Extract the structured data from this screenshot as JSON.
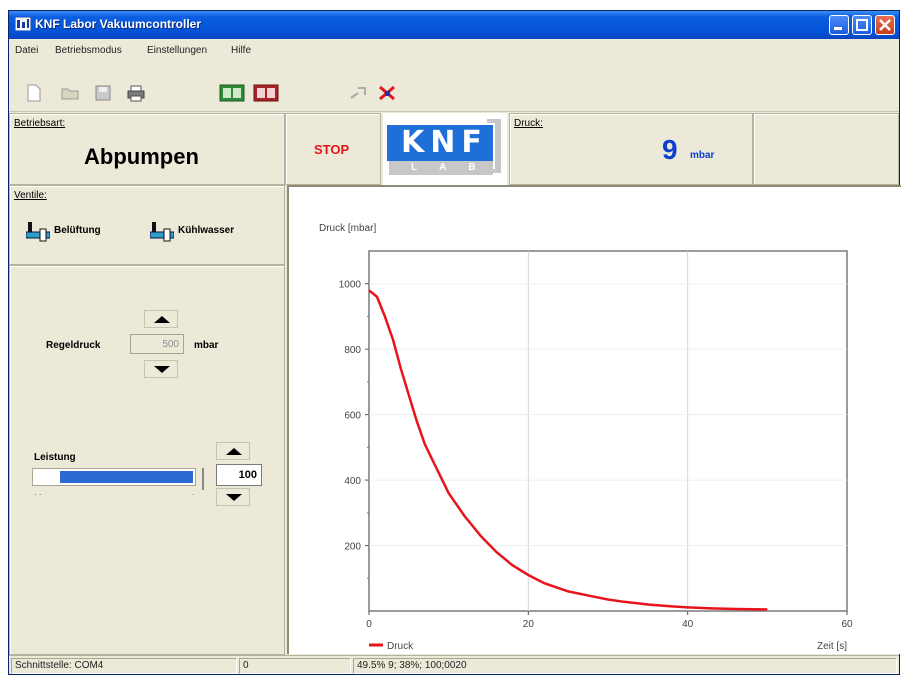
{
  "window": {
    "title": "KNF Labor Vakuumcontroller"
  },
  "menu": [
    "Datei",
    "Betriebsmodus",
    "Einstellungen",
    "Hilfe"
  ],
  "status_panel": {
    "label": "Betriebsart:",
    "value": "Abpumpen"
  },
  "stop_button": {
    "label": "STOP"
  },
  "logo": {
    "top": "KNF",
    "bottom": "LAB"
  },
  "pressure_panel": {
    "label": "Druck:",
    "value": "9",
    "unit": "mbar"
  },
  "valves": {
    "label": "Ventile:",
    "items": [
      {
        "label": "Belüftung"
      },
      {
        "label": "Kühlwasser"
      }
    ]
  },
  "setpoint": {
    "label": "Regeldruck",
    "value": "500",
    "unit": "mbar"
  },
  "power": {
    "label": "Leistung",
    "value": "100",
    "fill_fraction": 0.83
  },
  "chart_data": {
    "type": "line",
    "ylabel": "Druck [mbar]",
    "xlabel": "Zeit [s]",
    "xlim": [
      0,
      60
    ],
    "ylim": [
      0,
      1100
    ],
    "x_ticks": [
      0,
      20,
      40,
      60
    ],
    "y_ticks": [
      200,
      400,
      600,
      800,
      1000
    ],
    "grid": true,
    "legend_position": "bottom-left",
    "series": [
      {
        "name": "Druck",
        "color": "#e8141c",
        "x": [
          0,
          1,
          2,
          3,
          4,
          5,
          6,
          7,
          8,
          9,
          10,
          12,
          14,
          16,
          18,
          20,
          22,
          25,
          28,
          30,
          32,
          35,
          38,
          40,
          43,
          46,
          50
        ],
        "y": [
          980,
          960,
          900,
          830,
          740,
          660,
          580,
          510,
          460,
          410,
          360,
          290,
          230,
          180,
          140,
          110,
          85,
          60,
          45,
          35,
          28,
          20,
          14,
          11,
          8,
          6,
          5
        ]
      }
    ]
  },
  "statusbar": {
    "port": "Schnittstelle: COM4",
    "counter": "0",
    "info": "49.5%   9;  38%;  100;0020"
  },
  "colors": {
    "accent": "#0a3fd0",
    "stop": "#e8141c",
    "bar": "#2b6ad0"
  }
}
